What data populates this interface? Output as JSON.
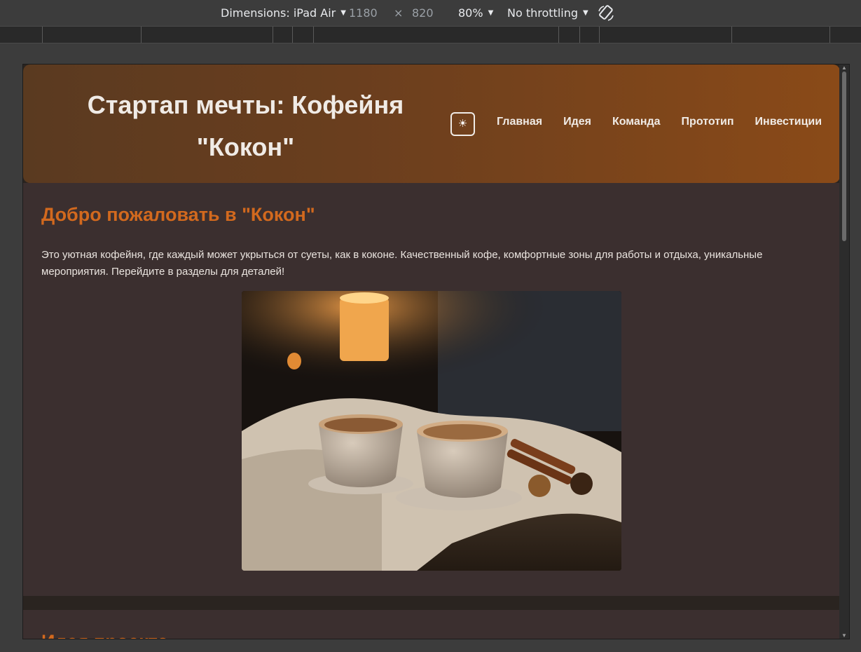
{
  "devtools": {
    "dimensions_label": "Dimensions: iPad Air",
    "width": "1180",
    "times": "×",
    "height": "820",
    "zoom": "80%",
    "throttling": "No throttling",
    "rotate_icon": "rotate-icon"
  },
  "site": {
    "title": "Стартап мечты: Кофейня \"Кокон\"",
    "theme_toggle_icon": "☀",
    "nav": [
      "Главная",
      "Идея",
      "Команда",
      "Прототип",
      "Инвестиции"
    ]
  },
  "welcome": {
    "heading": "Добро пожаловать в \"Кокон\"",
    "text": "Это уютная кофейня, где каждый может укрыться от суеты, как в коконе. Качественный кофе, комфортные зоны для работы и отдыха, уникальные мероприятия. Перейдите в разделы для деталей!"
  },
  "idea": {
    "heading": "Идея проекта"
  },
  "colors": {
    "accent": "#d2691e",
    "section_bg": "#3b2f2f",
    "header_from": "#5a3a20",
    "header_to": "#8a4a18"
  }
}
